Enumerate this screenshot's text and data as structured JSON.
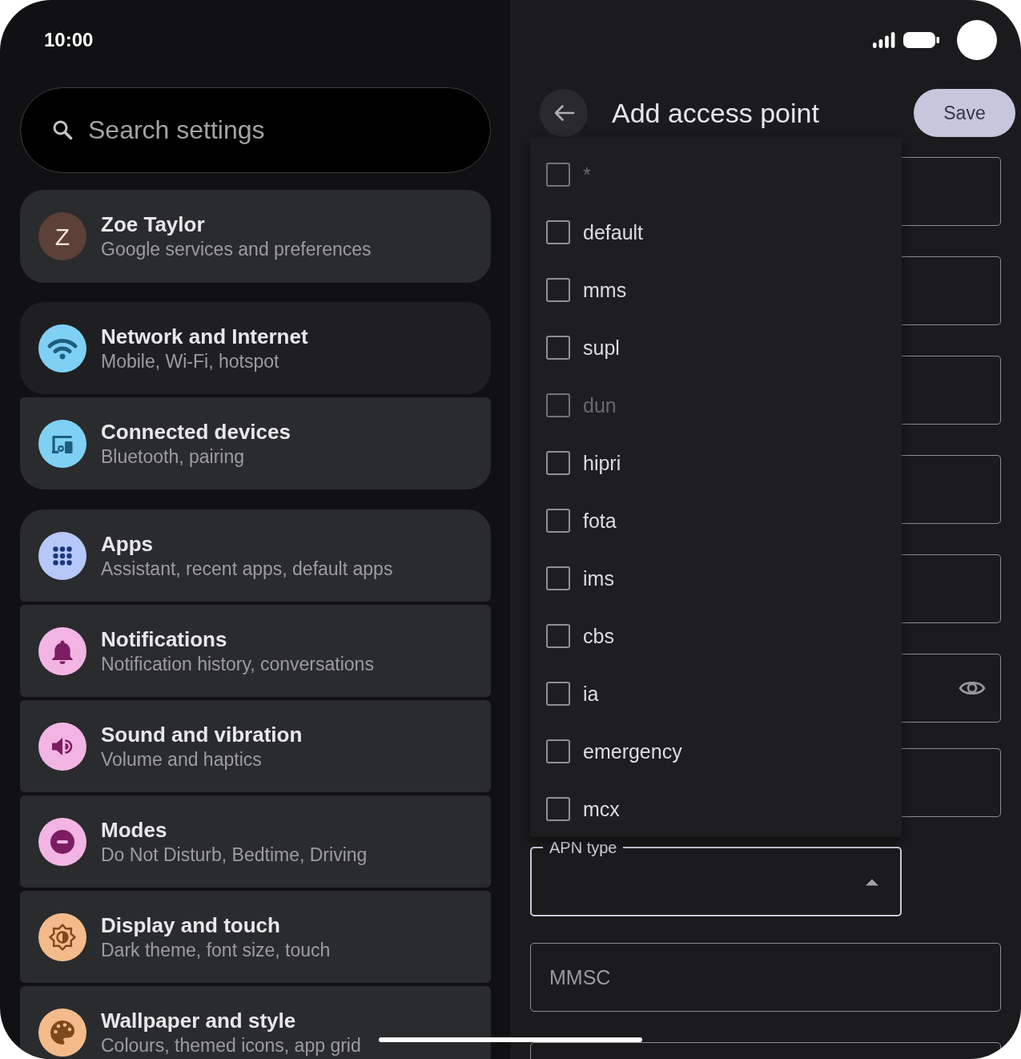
{
  "status_bar": {
    "time": "10:00"
  },
  "search": {
    "placeholder": "Search settings"
  },
  "account": {
    "initial": "Z",
    "name": "Zoe Taylor",
    "subtitle": "Google services and preferences"
  },
  "settings_groups": [
    {
      "items": [
        {
          "title": "Network and Internet",
          "subtitle": "Mobile, Wi-Fi, hotspot",
          "color": "#7fd0f5",
          "selected": true
        },
        {
          "title": "Connected devices",
          "subtitle": "Bluetooth, pairing",
          "color": "#7fd0f5",
          "selected": false
        }
      ]
    },
    {
      "items": [
        {
          "title": "Apps",
          "subtitle": "Assistant, recent apps, default apps",
          "color": "#b5c8f7",
          "selected": false
        },
        {
          "title": "Notifications",
          "subtitle": "Notification history, conversations",
          "color": "#f2b5e3",
          "selected": false
        },
        {
          "title": "Sound and vibration",
          "subtitle": "Volume and haptics",
          "color": "#f2b5e3",
          "selected": false
        },
        {
          "title": "Modes",
          "subtitle": "Do Not Disturb, Bedtime, Driving",
          "color": "#f2b5e3",
          "selected": false
        },
        {
          "title": "Display and touch",
          "subtitle": "Dark theme, font size, touch",
          "color": "#f4bb8a",
          "selected": false
        },
        {
          "title": "Wallpaper and style",
          "subtitle": "Colours, themed icons, app grid",
          "color": "#f4bb8a",
          "selected": false
        }
      ]
    }
  ],
  "detail": {
    "title": "Add access point",
    "save_label": "Save",
    "fields": [
      {
        "kind": "text"
      },
      {
        "kind": "text"
      },
      {
        "kind": "text"
      },
      {
        "kind": "text"
      },
      {
        "kind": "text"
      },
      {
        "kind": "password"
      },
      {
        "kind": "text"
      },
      {
        "kind": "dropdown",
        "label": "APN type",
        "expanded": true,
        "options": [
          {
            "label": "*",
            "checked": false,
            "disabled": true
          },
          {
            "label": "default",
            "checked": false,
            "disabled": false
          },
          {
            "label": "mms",
            "checked": false,
            "disabled": false
          },
          {
            "label": "supl",
            "checked": false,
            "disabled": false
          },
          {
            "label": "dun",
            "checked": false,
            "disabled": true
          },
          {
            "label": "hipri",
            "checked": false,
            "disabled": false
          },
          {
            "label": "fota",
            "checked": false,
            "disabled": false
          },
          {
            "label": "ims",
            "checked": false,
            "disabled": false
          },
          {
            "label": "cbs",
            "checked": false,
            "disabled": false
          },
          {
            "label": "ia",
            "checked": false,
            "disabled": false
          },
          {
            "label": "emergency",
            "checked": false,
            "disabled": false
          },
          {
            "label": "mcx",
            "checked": false,
            "disabled": false
          }
        ]
      },
      {
        "kind": "text",
        "placeholder": "MMSC"
      },
      {
        "kind": "text"
      }
    ]
  }
}
